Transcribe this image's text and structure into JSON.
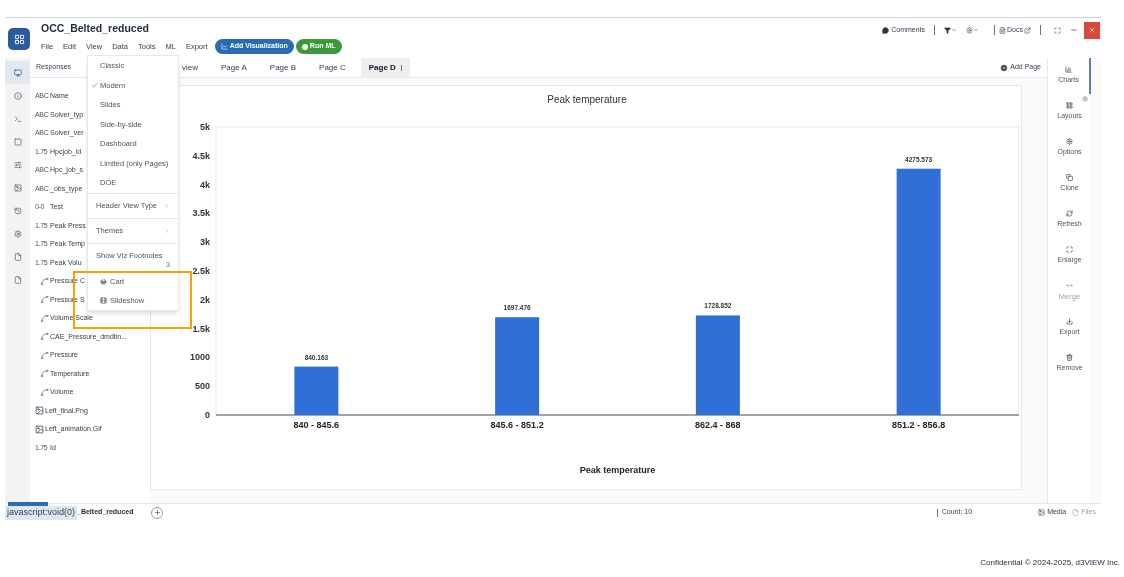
{
  "window": {
    "title": "OCC_Belted_reduced"
  },
  "menu_bar": [
    "File",
    "Edit",
    "View",
    "Data",
    "Tools",
    "ML",
    "Export"
  ],
  "actions": [
    {
      "label": "Add Visualization",
      "kind": "visualize"
    },
    {
      "label": "Run ML",
      "kind": "ml"
    }
  ],
  "toolbar_right": {
    "comments": "Comments",
    "docs": "Docs"
  },
  "left_rail": [
    {
      "selected": true
    },
    {
      "selected": false
    },
    {
      "selected": false
    },
    {
      "selected": false
    },
    {
      "selected": false
    },
    {
      "selected": false
    },
    {
      "selected": false
    },
    {
      "selected": false
    },
    {
      "selected": false
    },
    {
      "selected": false
    }
  ],
  "sidebar": {
    "title": "Responses",
    "fields": [
      {
        "kind": "text",
        "type_label": "ABC",
        "name": "Name"
      },
      {
        "kind": "text",
        "type_label": "ABC",
        "name": "Solver_typ"
      },
      {
        "kind": "text",
        "type_label": "ABC",
        "name": "Solver_ver"
      },
      {
        "kind": "number",
        "type_label": "1.75",
        "name": "Hpcjob_id"
      },
      {
        "kind": "text",
        "type_label": "ABC",
        "name": "Hpc_job_s"
      },
      {
        "kind": "text",
        "type_label": "ABC",
        "name": "_obs_type"
      },
      {
        "kind": "bool",
        "type_label": "0-0",
        "name": "Test"
      },
      {
        "kind": "number",
        "type_label": "1.75",
        "name": "Peak Press"
      },
      {
        "kind": "number",
        "type_label": "1.75",
        "name": "Peak Temp"
      },
      {
        "kind": "number",
        "type_label": "1.75",
        "name": "Peak Volu"
      },
      {
        "kind": "curve",
        "name": "Pressure C"
      },
      {
        "kind": "curve",
        "name": "Pressure S"
      },
      {
        "kind": "curve",
        "name": "Volume Scale"
      },
      {
        "kind": "curve",
        "name": "CAE_Pressure_dmdtin..."
      },
      {
        "kind": "curve",
        "name": "Pressure"
      },
      {
        "kind": "curve",
        "name": "Temperature"
      },
      {
        "kind": "curve",
        "name": "Volume"
      },
      {
        "kind": "image",
        "name": "Left_final.Png"
      },
      {
        "kind": "image",
        "name": "Left_animation.Gif"
      },
      {
        "kind": "number",
        "type_label": "1.75",
        "name": "Id"
      }
    ]
  },
  "tabs": [
    {
      "label": "view",
      "selected": false
    },
    {
      "label": "Page A",
      "selected": false
    },
    {
      "label": "Page B",
      "selected": false
    },
    {
      "label": "Page C",
      "selected": false
    },
    {
      "label": "Page D",
      "selected": true
    }
  ],
  "add_page": "Add Page",
  "chart_panel": {
    "chart_data": {
      "type": "bar",
      "title": "Peak temperature",
      "xlabel": "Peak temperature",
      "categories": [
        "840 - 845.6",
        "845.6 - 851.2",
        "862.4 - 868",
        "851.2 - 856.8"
      ],
      "series": [
        {
          "color": "#2f6fd6",
          "values": [
            840.163,
            1697.476,
            1728.852,
            4275.573
          ]
        }
      ],
      "value_labels": [
        "840.163",
        "1697.476",
        "1728.852",
        "4275.573"
      ],
      "ylim": [
        0,
        5000
      ],
      "yticks": [
        {
          "value": 0,
          "label": "0"
        },
        {
          "value": 500,
          "label": "500"
        },
        {
          "value": 1000,
          "label": "1000"
        },
        {
          "value": 1500,
          "label": "1.5k"
        },
        {
          "value": 2000,
          "label": "2k"
        },
        {
          "value": 2500,
          "label": "2.5k"
        },
        {
          "value": 3000,
          "label": "3k"
        },
        {
          "value": 3500,
          "label": "3.5k"
        },
        {
          "value": 4000,
          "label": "4k"
        },
        {
          "value": 4500,
          "label": "4.5k"
        },
        {
          "value": 5000,
          "label": "5k"
        }
      ]
    }
  },
  "right_rail": [
    {
      "label": "Charts",
      "selected": true,
      "disabled": false
    },
    {
      "label": "Layouts",
      "selected": false,
      "disabled": false
    },
    {
      "label": "Options",
      "selected": false,
      "disabled": false
    },
    {
      "label": "Clone",
      "selected": false,
      "disabled": false
    },
    {
      "label": "Refresh",
      "selected": false,
      "disabled": false
    },
    {
      "label": "Enlarge",
      "selected": false,
      "disabled": false
    },
    {
      "label": "Merge",
      "selected": false,
      "disabled": true
    },
    {
      "label": "Export",
      "selected": false,
      "disabled": false
    },
    {
      "label": "Remove",
      "selected": false,
      "disabled": false
    }
  ],
  "view_menu": {
    "items": [
      {
        "kind": "option",
        "label": "Classic",
        "checked": false
      },
      {
        "kind": "option",
        "label": "Modern",
        "checked": true
      },
      {
        "kind": "option",
        "label": "Slides",
        "checked": false
      },
      {
        "kind": "option",
        "label": "Side-by-side",
        "checked": false
      },
      {
        "kind": "option",
        "label": "Dashboard",
        "checked": false
      },
      {
        "kind": "option",
        "label": "Limited (only Pages)",
        "checked": false
      },
      {
        "kind": "option",
        "label": "DOE",
        "checked": false
      },
      {
        "kind": "submenu",
        "label": "Header View Type"
      },
      {
        "kind": "submenu",
        "label": "Themes"
      },
      {
        "kind": "footnote",
        "label": "Show Viz Footnotes",
        "badge": "3"
      },
      {
        "kind": "cart",
        "label": "Cart"
      },
      {
        "kind": "slideshow",
        "label": "Slideshow"
      }
    ]
  },
  "bottom_bar": {
    "status_link": "javascript:void(0)",
    "doc_tab": "_Belted_reduced",
    "count": "Count: 10",
    "media": "Media",
    "files": "Files"
  },
  "footer": "Confidential © 2024-2025, d3VIEW Inc."
}
